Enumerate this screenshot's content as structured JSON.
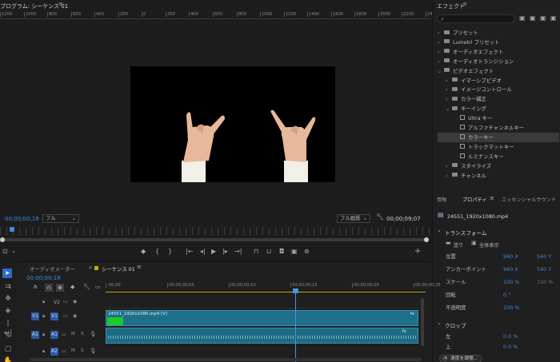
{
  "program": {
    "title": "プログラム: シーケンス 01",
    "ruler_labels": [
      "1200",
      "1000",
      "800",
      "600",
      "400",
      "200",
      "0",
      "200",
      "400",
      "600",
      "800",
      "1000",
      "1200",
      "1400",
      "1600",
      "1800",
      "2000",
      "2200",
      "2400"
    ],
    "timecode": "00;00;00;16",
    "fit": "フル",
    "quality": "フル画質",
    "duration": "00;00;09;07"
  },
  "effects": {
    "title": "エフェクト",
    "search_placeholder": "",
    "items": [
      {
        "label": "プリセット",
        "level": 0,
        "type": "folder",
        "open": false
      },
      {
        "label": "Lumetri プリセット",
        "level": 0,
        "type": "folder",
        "open": false
      },
      {
        "label": "オーディオエフェクト",
        "level": 0,
        "type": "folder",
        "open": false
      },
      {
        "label": "オーディオトランジション",
        "level": 0,
        "type": "folder",
        "open": false
      },
      {
        "label": "ビデオエフェクト",
        "level": 0,
        "type": "folder",
        "open": true
      },
      {
        "label": "イマーシブビデオ",
        "level": 1,
        "type": "folder",
        "open": false
      },
      {
        "label": "イメージコントロール",
        "level": 1,
        "type": "folder",
        "open": false
      },
      {
        "label": "カラー補正",
        "level": 1,
        "type": "folder",
        "open": false
      },
      {
        "label": "キーイング",
        "level": 1,
        "type": "folder",
        "open": true
      },
      {
        "label": "Ultra キー",
        "level": 2,
        "type": "fx",
        "open": false
      },
      {
        "label": "アルファチャンネルキー",
        "level": 2,
        "type": "fx",
        "open": false
      },
      {
        "label": "カラーキー",
        "level": 2,
        "type": "fx",
        "open": false,
        "selected": true
      },
      {
        "label": "トラックマットキー",
        "level": 2,
        "type": "fx",
        "open": false
      },
      {
        "label": "ルミナンスキー",
        "level": 2,
        "type": "fx",
        "open": false
      },
      {
        "label": "スタイライズ",
        "level": 1,
        "type": "folder",
        "open": false
      },
      {
        "label": "チャンネル",
        "level": 1,
        "type": "folder",
        "open": false
      }
    ]
  },
  "properties": {
    "tabs": [
      "情報",
      "プロパティ",
      "エッセンシャルサウンド"
    ],
    "file": "24551_1920x1080.mp4",
    "transform_title": "トランスフォーム",
    "fit_label": "塗り",
    "fill_label": "全体表示",
    "rows": [
      {
        "label": "位置",
        "v1": "960 X",
        "v2": "540 Y"
      },
      {
        "label": "アンカーポイント",
        "v1": "960 X",
        "v2": "540 Y"
      },
      {
        "label": "スケール",
        "v1": "100 %",
        "v2": "100 %"
      },
      {
        "label": "回転",
        "v1": "0 °",
        "v2": ""
      },
      {
        "label": "不透明度",
        "v1": "100 %",
        "v2": ""
      }
    ],
    "crop_title": "クロップ",
    "crop_rows": [
      {
        "label": "左",
        "v1": "0.0 %"
      },
      {
        "label": "上",
        "v1": "0.0 %"
      }
    ],
    "button": "速度を調整..."
  },
  "timeline": {
    "tabs": [
      "オーディオメーター",
      "シーケンス 01"
    ],
    "timecode": "00;00;00;16",
    "ruler": [
      ":00;00",
      "00;00;00;05",
      "00;00;00;10",
      "00;00;00;15",
      "00;00;00;20",
      "00;00;00;25"
    ],
    "tracks": [
      {
        "name": "V2",
        "kind": "video"
      },
      {
        "name": "V1",
        "kind": "video"
      },
      {
        "name": "A1",
        "kind": "audio"
      },
      {
        "name": "A2",
        "kind": "audio"
      }
    ],
    "clip_label": "24551_1920x1080.mp4 [V]",
    "fx_label": "fx"
  },
  "colors": {
    "accent": "#3f8bdc",
    "clip_video": "#1f6f8b",
    "clip_audio": "#1e6b84",
    "playhead": "#4a90e2",
    "green": "#1bcb2b"
  }
}
